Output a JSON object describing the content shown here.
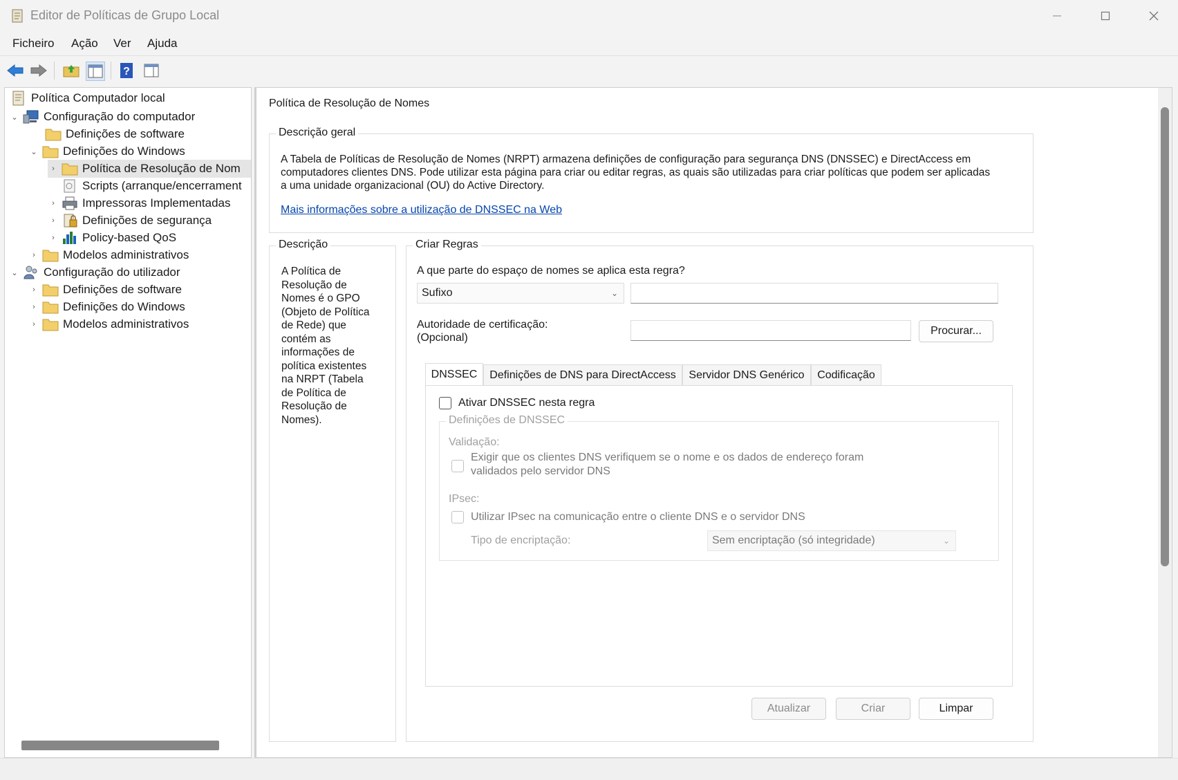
{
  "window": {
    "title": "Editor de Políticas de Grupo Local"
  },
  "menu": [
    "Ficheiro",
    "Ação",
    "Ver",
    "Ajuda"
  ],
  "tree": {
    "root": "Política Computador local",
    "computer_config": "Configuração do computador",
    "sw_settings_1": "Definições de software",
    "win_settings_1": "Definições do Windows",
    "nrpt": "Política de Resolução de Nom",
    "scripts": "Scripts (arranque/encerrament",
    "printers": "Impressoras Implementadas",
    "security": "Definições de segurança",
    "qos": "Policy-based QoS",
    "admin_templates_1": "Modelos administrativos",
    "user_config": "Configuração do utilizador",
    "sw_settings_2": "Definições de software",
    "win_settings_2": "Definições do Windows",
    "admin_templates_2": "Modelos administrativos"
  },
  "main": {
    "title": "Política de Resolução de Nomes",
    "overview": {
      "label": "Descrição geral",
      "line1": "A Tabela de Políticas de Resolução de Nomes (NRPT) armazena definições de configuração para segurança DNS (DNSSEC) e DirectAccess em",
      "line2": "computadores clientes DNS. Pode utilizar esta página para criar ou editar regras, as quais são utilizadas para criar políticas que podem ser aplicadas",
      "line3": "a uma unidade organizacional (OU) do Active Directory.",
      "link": "Mais informações sobre a utilização de DNSSEC na Web"
    },
    "description": {
      "label": "Descrição",
      "lines": [
        "A Política de",
        "Resolução de",
        "Nomes é o GPO",
        "(Objeto de Política",
        "de Rede) que",
        "contém as",
        "informações de",
        "política existentes",
        "na NRPT (Tabela",
        "de Política de",
        "Resolução de",
        "Nomes)."
      ]
    },
    "create_rules": {
      "label": "Criar Regras",
      "question": "A que parte do espaço de nomes se aplica esta regra?",
      "namespace_type": "Sufixo",
      "namespace_value": "",
      "ca_label_1": "Autoridade de certificação:",
      "ca_label_2": "(Opcional)",
      "ca_value": "",
      "browse": "Procurar...",
      "tabs": [
        "DNSSEC",
        "Definições de DNS para DirectAccess",
        "Servidor DNS Genérico",
        "Codificação"
      ],
      "enable_dnssec": "Ativar DNSSEC nesta regra",
      "dnssec_group": "Definições de DNSSEC",
      "validation_label": "Validação:",
      "validation_check_1": "Exigir que os clientes DNS verifiquem se o nome e os dados de endereço foram",
      "validation_check_2": "validados pelo servidor DNS",
      "ipsec_label": "IPsec:",
      "ipsec_check": "Utilizar IPsec na comunicação entre o cliente DNS e o servidor DNS",
      "encryption_label": "Tipo de encriptação:",
      "encryption_value": "Sem encriptação (só integridade)",
      "update": "Atualizar",
      "create": "Criar",
      "clear": "Limpar"
    }
  }
}
